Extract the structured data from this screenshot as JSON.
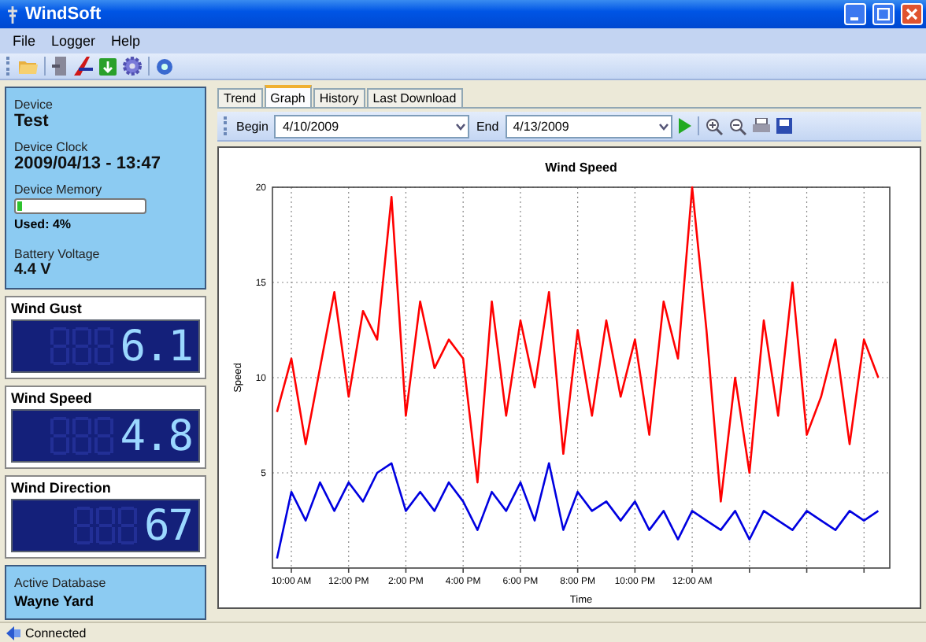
{
  "window": {
    "title": "WindSoft"
  },
  "menu": [
    "File",
    "Logger",
    "Help"
  ],
  "device": {
    "device_label": "Device",
    "device_name": "Test",
    "clock_label": "Device Clock",
    "clock": "2009/04/13 - 13:47",
    "memory_label": "Device Memory",
    "memory": {
      "level": 0.04
    },
    "used": "Used:  4%",
    "battery_label": "Battery Voltage",
    "battery": "4.4 V"
  },
  "readouts": [
    {
      "label": "Wind Gust",
      "value": "6.1"
    },
    {
      "label": "Wind Speed",
      "value": "4.8"
    },
    {
      "label": "Wind Direction",
      "value": "67"
    }
  ],
  "database": {
    "label": "Active Database",
    "name": "Wayne Yard"
  },
  "tabs": [
    {
      "label": "Trend",
      "selected": false
    },
    {
      "label": "Graph",
      "selected": true
    },
    {
      "label": "History",
      "selected": false
    },
    {
      "label": "Last Download",
      "selected": false
    }
  ],
  "range": {
    "begin_label": "Begin",
    "begin": "4/10/2009",
    "end_label": "End",
    "end": "4/13/2009"
  },
  "chart_data": {
    "type": "line",
    "title": "Wind Speed",
    "xlabel": "Time",
    "ylabel": "Speed",
    "xlim": [
      9.34,
      30.9
    ],
    "ylim": [
      0,
      20
    ],
    "yticks": [
      5,
      10,
      15,
      20
    ],
    "xticks": [
      {
        "value": 10,
        "label": "10:00 AM"
      },
      {
        "value": 12,
        "label": "12:00 PM"
      },
      {
        "value": 14,
        "label": "2:00 PM"
      },
      {
        "value": 16,
        "label": "4:00 PM"
      },
      {
        "value": 18,
        "label": "6:00 PM"
      },
      {
        "value": 20,
        "label": "8:00 PM"
      },
      {
        "value": 22,
        "label": "10:00 PM"
      },
      {
        "value": 24,
        "label": "12:00 AM"
      }
    ],
    "grid": true,
    "x": [
      9.5,
      10,
      10.5,
      11,
      11.5,
      12,
      12.5,
      13,
      13.5,
      14,
      14.5,
      15,
      15.5,
      16,
      16.5,
      17,
      17.5,
      18,
      18.5,
      19,
      19.5,
      20,
      20.5,
      21,
      21.5,
      22,
      22.5,
      23,
      23.5,
      24,
      24.5,
      25,
      25.5,
      26,
      26.5,
      27,
      27.5,
      28,
      28.5,
      29,
      29.5,
      30,
      30.5
    ],
    "series": [
      {
        "color": "#ff0000",
        "values": [
          8.2,
          11,
          6.5,
          10.5,
          14.5,
          9,
          13.5,
          12,
          19.5,
          8,
          14,
          10.5,
          12,
          11,
          4.5,
          14,
          8,
          13,
          9.5,
          14.5,
          6,
          12.5,
          8,
          13,
          9,
          12,
          7,
          14,
          11,
          20,
          12.5,
          3.5,
          10,
          5,
          13,
          8,
          15,
          7,
          9,
          12,
          6.5,
          12,
          10
        ]
      },
      {
        "color": "#0000e0",
        "values": [
          0.5,
          4,
          2.5,
          4.5,
          3,
          4.5,
          3.5,
          5,
          5.5,
          3,
          4,
          3,
          4.5,
          3.5,
          2,
          4,
          3,
          4.5,
          2.5,
          5.5,
          2,
          4,
          3,
          3.5,
          2.5,
          3.5,
          2,
          3,
          1.5,
          3,
          2.5,
          2,
          3,
          1.5,
          3,
          2.5,
          2,
          3,
          2.5,
          2,
          3,
          2.5,
          3
        ]
      }
    ]
  },
  "status_bar": {
    "text": "Connected"
  }
}
